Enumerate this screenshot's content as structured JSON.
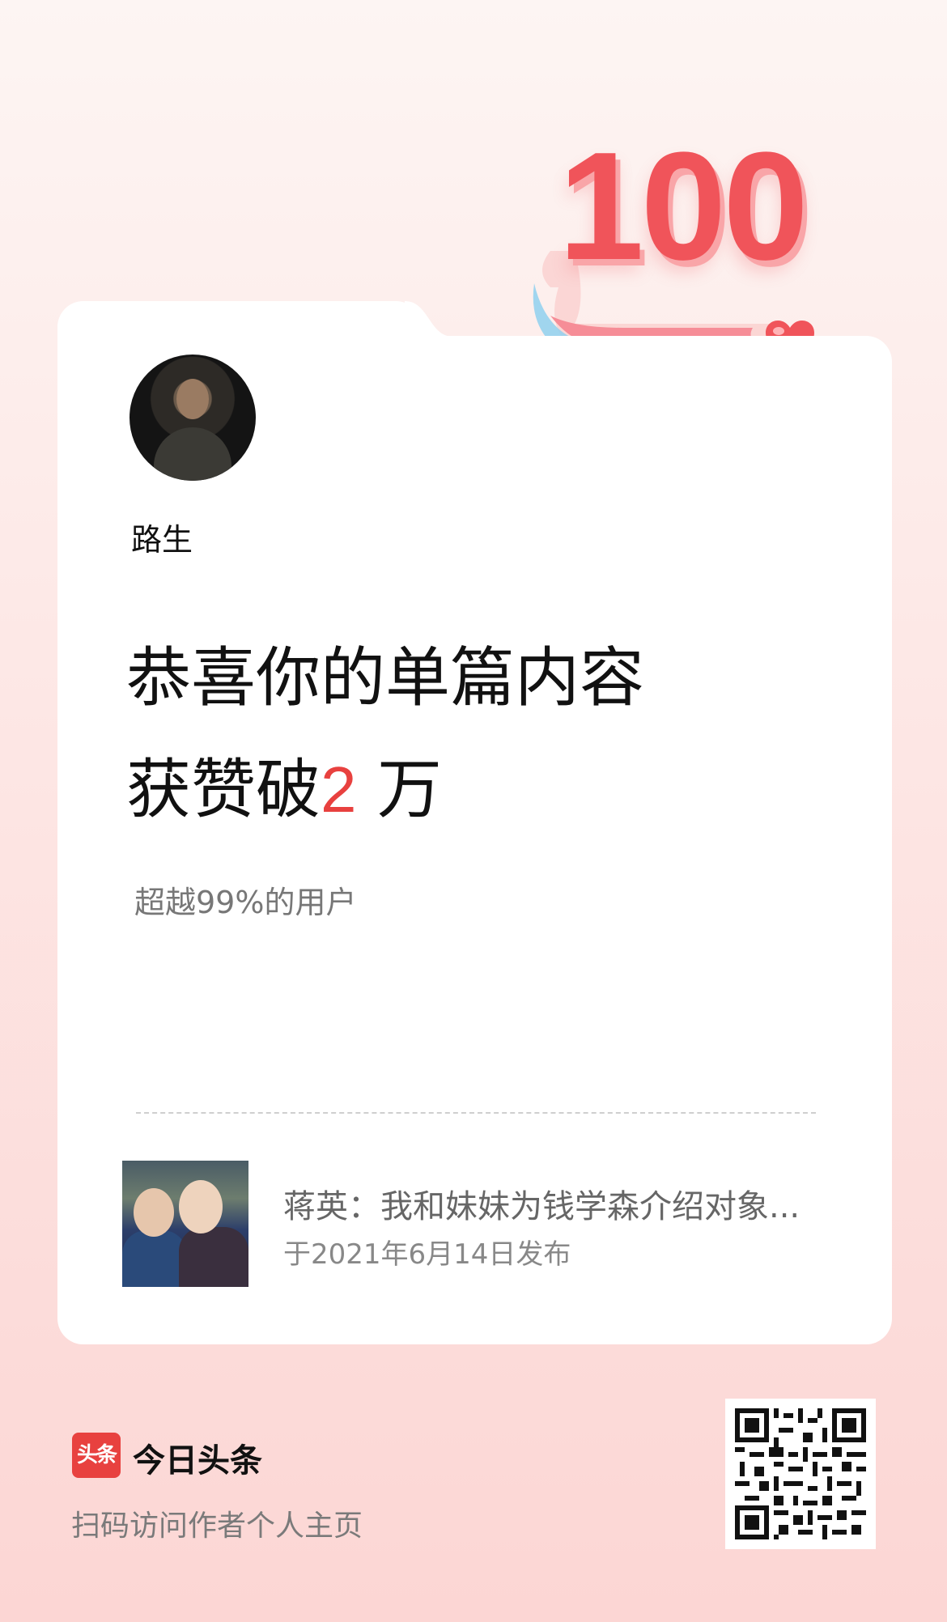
{
  "badge": {
    "number": "100",
    "heart_color": "#f0545a"
  },
  "user": {
    "name": "路生"
  },
  "headline": {
    "line1": "恭喜你的单篇内容",
    "line2_prefix": "获赞破",
    "line2_number": "2",
    "line2_suffix": " 万"
  },
  "subline": "超越99%的用户",
  "article": {
    "title": "蒋英：我和妹妹为钱学森介绍对象...",
    "date": "于2021年6月14日发布"
  },
  "footer": {
    "logo_icon_text": "头条",
    "app_name": "今日头条",
    "scan_hint": "扫码访问作者个人主页"
  },
  "colors": {
    "accent": "#e8413f",
    "text": "#111111",
    "muted": "#777777"
  }
}
